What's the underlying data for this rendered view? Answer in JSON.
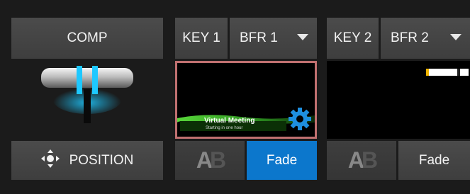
{
  "comp": {
    "label": "COMP"
  },
  "tbar": {
    "accent": "#1ec8ff"
  },
  "position": {
    "label": "POSITION"
  },
  "key1": {
    "label": "KEY 1",
    "buffer": "BFR 1",
    "lowerthird_title": "Virtual Meeting",
    "lowerthird_sub": "Starting in one hour",
    "fade": "Fade"
  },
  "key2": {
    "label": "KEY 2",
    "buffer": "BFR 2",
    "fade": "Fade"
  },
  "ab_glyph": {
    "a": "A",
    "b": "B"
  },
  "colors": {
    "fade_active": "#0c77cc",
    "selection_border": "#c07070",
    "gear": "#1e8fe0",
    "lowerthird_green": "#3bbf2a"
  }
}
